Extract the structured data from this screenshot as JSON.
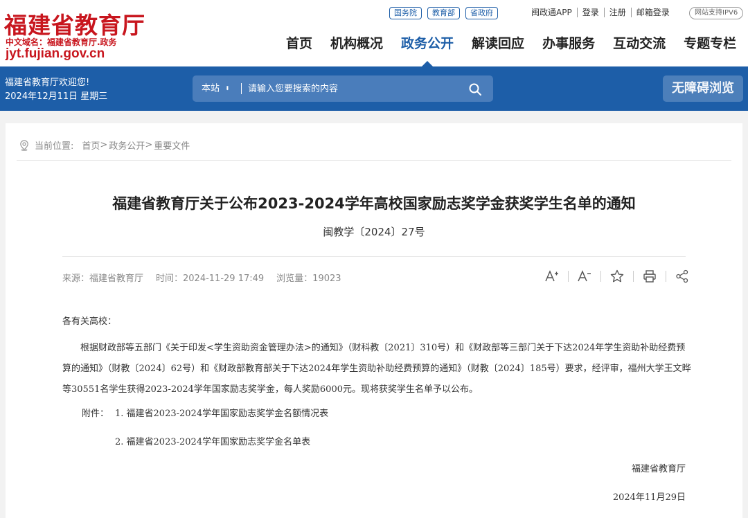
{
  "site": {
    "logo_title": "福建省教育厅",
    "logo_subtitle": "中文域名：福建省教育厅.政务",
    "logo_domain": "jyt.fujian.gov.cn",
    "brand_color": "#c8161e",
    "accent_color": "#1d5ea8"
  },
  "gov_links": [
    "国务院",
    "教育部",
    "省政府"
  ],
  "top_links": [
    "闽政通APP",
    "登录",
    "注册",
    "邮箱登录"
  ],
  "ipv6_badge": "网站支持IPV6",
  "nav": {
    "items": [
      "首页",
      "机构概况",
      "政务公开",
      "解读回应",
      "办事服务",
      "互动交流",
      "专题专栏"
    ],
    "active": "政务公开"
  },
  "welcome": {
    "line1": "福建省教育厅欢迎您!",
    "line2": "2024年12月11日 星期三"
  },
  "search": {
    "scope": "本站",
    "placeholder": "请输入您要搜索的内容"
  },
  "accessibility_button": "无障碍浏览",
  "breadcrumb": {
    "label": "当前位置:",
    "items": [
      "首页",
      "政务公开",
      "重要文件"
    ]
  },
  "article": {
    "title": "福建省教育厅关于公布2023-2024学年高校国家励志奖学金获奖学生名单的通知",
    "doc_number": "闽教学〔2024〕27号",
    "source": "来源：福建省教育厅",
    "time": "时间：2024-11-29 17:49",
    "views": "浏览量：19023",
    "salutation": "各有关高校：",
    "paragraph": "根据财政部等五部门《关于印发<学生资助资金管理办法>的通知》（财科教〔2021〕310号）和《财政部等三部门关于下达2024年学生资助补助经费预算的通知》（财教〔2024〕62号）和《财政部教育部关于下达2024年学生资助补助经费预算的通知》（财教〔2024〕185号）要求，经评审，福州大学王文晔等30551名学生获得2023-2024学年国家励志奖学金，每人奖励6000元。现将获奖学生名单予以公布。",
    "attachment_label": "附件：",
    "attachment_1": "1. 福建省2023-2024学年国家励志奖学金名额情况表",
    "attachment_2": "2. 福建省2023-2024学年国家励志奖学金名单表",
    "signer": "福建省教育厅",
    "date": "2024年11月29日"
  },
  "tools": [
    "font-larger-icon",
    "font-smaller-icon",
    "star-icon",
    "print-icon",
    "share-icon"
  ]
}
